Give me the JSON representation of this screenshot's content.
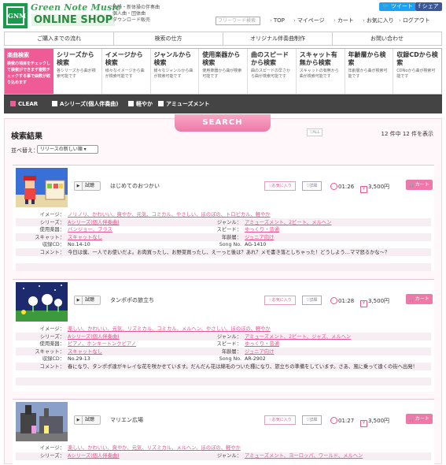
{
  "header": {
    "logo_text": "GNM",
    "brand_top": "Green Note Music",
    "brand_bottom": "ONLINE SHOP",
    "sublines": [
      "体操・新体操の伴奏曲",
      "個人曲・団体曲",
      "ダウンロード販売"
    ],
    "tweet": "ツイート",
    "share": "シェア",
    "search_placeholder": "フリーワード検索",
    "nav": [
      "TOP",
      "マイページ",
      "カート",
      "お気に入り",
      "ログアウト"
    ]
  },
  "mainnav": [
    "ご購入までの流れ",
    "検索の仕方",
    "オリジナル伴奏曲制作",
    "お問い合わせ"
  ],
  "categories": {
    "first": {
      "title": "楽曲検索",
      "desc": "検索の項目をチェックして検索ができます複数チェックする事で曲数が絞り込めます"
    },
    "items": [
      {
        "title": "シリーズから検索",
        "desc": "各シリーズから曲が検索可能です"
      },
      {
        "title": "イメージから検索",
        "desc": "様々なイメージから曲が検索可能です"
      },
      {
        "title": "ジャンルから検索",
        "desc": "様々なジャンルから曲が検索可能です"
      },
      {
        "title": "使用楽器から検索",
        "desc": "使用楽器から曲が検索可能です"
      },
      {
        "title": "曲のスピードから検索",
        "desc": "曲のスピードの早さから曲が検索可能です"
      },
      {
        "title": "スキャット有無から検索",
        "desc": "スキャットの有無から曲が検索可能です"
      },
      {
        "title": "年齢層から検索",
        "desc": "年齢層から曲が検索可能です"
      },
      {
        "title": "収録CDから検索",
        "desc": "CDNoから曲が検索可能です"
      }
    ]
  },
  "filters": {
    "clear": "CLEAR",
    "chips": [
      "Aシリーズ(個人伴奏曲)",
      "軽やか",
      "アミューズメント"
    ]
  },
  "search_button": "SEARCH",
  "results": {
    "title": "検索結果",
    "all_button": "▽ALL",
    "count": "12 件中 12 件を表示",
    "sort_label": "並べ替え：",
    "sort_value": "リリースの新しい順",
    "trial": "試聴",
    "fav": "お気に入り",
    "detail": "詳細",
    "cart": "カート",
    "labels": {
      "image": "イメージ：",
      "series": "シリーズ：",
      "genre": "ジャンル：",
      "instrument": "使用楽器：",
      "speed": "スピード：",
      "scat": "スキャット：",
      "age": "年齢層：",
      "cd": "収録CD：",
      "songno": "Song No.",
      "comment": "コメント："
    },
    "items": [
      {
        "title": "はじめてのおつかい",
        "duration": "01:26",
        "price": "3,500円",
        "image": "ノリノリ、かわいい、爽やか、元気、コミカル、やさしい、ほのぼの、トロピカル、軽やか",
        "series": "Aシリーズ(個人伴奏曲)",
        "genre": "アミューズメント、2ビート、メルヘン",
        "instrument": "バンジョー、ブラス",
        "speed": "ゆっくり・普通",
        "scat": "スキャットなし",
        "age": "ジュニア向け",
        "cd": "No.14-10",
        "songno": "AG-1410",
        "comment": "今日は僕、一人でお使いだよ。お肉買ったし、お野菜買ったし、えーっと後は？あれ？メモ書き落としちゃった！どうしよう…ママ怒るかな～？"
      },
      {
        "title": "タンポポの旅立ち",
        "duration": "01:28",
        "price": "3,500円",
        "image": "楽しい、かわいい、元気、リズミカル、コミカル、メルヘン、やさしい、ほのぼの、軽やか",
        "series": "Aシリーズ(個人伴奏曲)",
        "genre": "アミューズメント、2ビート、ジャズ、メルヘン",
        "instrument": "ピアノ、ホンキートンクピアノ",
        "speed": "ゆっくり・普通",
        "scat": "スキャットなし",
        "age": "ジュニア向け",
        "cd": "No.29-13",
        "songno": "AR-2902",
        "comment": "春になり、タンポポ達がキレイな花を咲かせています。だんだん花は綿毛のついた種になり、旅立ちの準備をしています。さあ、風に乗って遠くの街へ出発！"
      },
      {
        "title": "マリエン広場",
        "duration": "01:27",
        "price": "3,500円",
        "image": "楽しい、かわいい、爽やか、元気、リズミカル、メルヘン、ほのぼの、軽やか",
        "series": "Aシリーズ(個人伴奏曲)",
        "genre": "アミューズメント、ヨーロッパ、ワールド、メルヘン"
      }
    ]
  },
  "colors": {
    "accent": "#ef5b96",
    "green": "#2b8a3e",
    "dark_bar": "#444444"
  }
}
